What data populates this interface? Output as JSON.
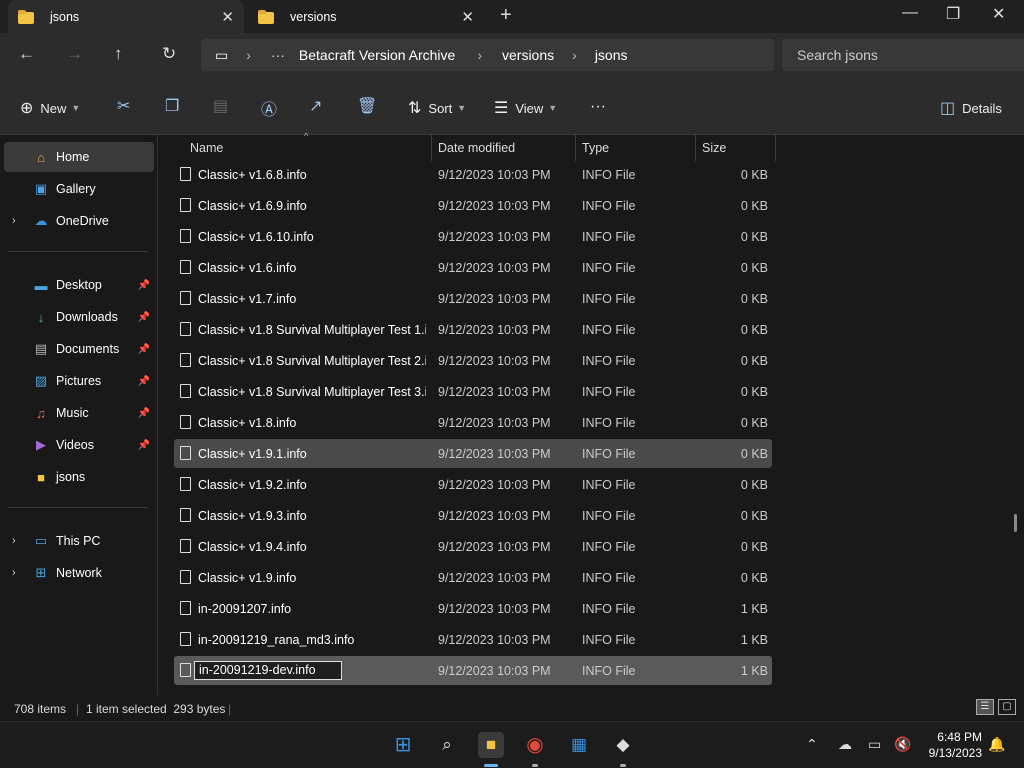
{
  "tabs": [
    {
      "label": "jsons",
      "active": true
    },
    {
      "label": "versions",
      "active": false
    }
  ],
  "breadcrumb": {
    "ellipsis": "···",
    "items": [
      "Betacraft Version Archive",
      "versions",
      "jsons"
    ]
  },
  "search": {
    "placeholder": "Search jsons"
  },
  "commands": {
    "new_label": "New",
    "sort_label": "Sort",
    "view_label": "View",
    "more_label": "···",
    "details_label": "Details"
  },
  "sidebar": {
    "items": [
      {
        "label": "Home",
        "icon": "home-icon",
        "selected": true
      },
      {
        "label": "Gallery",
        "icon": "gallery-icon"
      },
      {
        "label": "OneDrive",
        "icon": "cloud-icon"
      },
      {
        "label": "Desktop",
        "icon": "desktop-icon"
      },
      {
        "label": "Downloads",
        "icon": "download-icon"
      },
      {
        "label": "Documents",
        "icon": "documents-icon"
      },
      {
        "label": "Pictures",
        "icon": "pictures-icon"
      },
      {
        "label": "Music",
        "icon": "music-icon"
      },
      {
        "label": "Videos",
        "icon": "videos-icon"
      },
      {
        "label": "jsons",
        "icon": "folder-icon"
      },
      {
        "label": "This PC",
        "icon": "pc-icon"
      },
      {
        "label": "Network",
        "icon": "network-icon"
      }
    ]
  },
  "columns": {
    "name": "Name",
    "date": "Date modified",
    "type": "Type",
    "size": "Size"
  },
  "files": [
    {
      "name": "Classic+ v1.6.8.info",
      "date": "9/12/2023 10:03 PM",
      "type": "INFO File",
      "size": "0 KB"
    },
    {
      "name": "Classic+ v1.6.9.info",
      "date": "9/12/2023 10:03 PM",
      "type": "INFO File",
      "size": "0 KB"
    },
    {
      "name": "Classic+ v1.6.10.info",
      "date": "9/12/2023 10:03 PM",
      "type": "INFO File",
      "size": "0 KB"
    },
    {
      "name": "Classic+ v1.6.info",
      "date": "9/12/2023 10:03 PM",
      "type": "INFO File",
      "size": "0 KB"
    },
    {
      "name": "Classic+ v1.7.info",
      "date": "9/12/2023 10:03 PM",
      "type": "INFO File",
      "size": "0 KB"
    },
    {
      "name": "Classic+ v1.8 Survival Multiplayer Test 1.i...",
      "date": "9/12/2023 10:03 PM",
      "type": "INFO File",
      "size": "0 KB"
    },
    {
      "name": "Classic+ v1.8 Survival Multiplayer Test 2.i...",
      "date": "9/12/2023 10:03 PM",
      "type": "INFO File",
      "size": "0 KB"
    },
    {
      "name": "Classic+ v1.8 Survival Multiplayer Test 3.i...",
      "date": "9/12/2023 10:03 PM",
      "type": "INFO File",
      "size": "0 KB"
    },
    {
      "name": "Classic+ v1.8.info",
      "date": "9/12/2023 10:03 PM",
      "type": "INFO File",
      "size": "0 KB"
    },
    {
      "name": "Classic+ v1.9.1.info",
      "date": "9/12/2023 10:03 PM",
      "type": "INFO File",
      "size": "0 KB"
    },
    {
      "name": "Classic+ v1.9.2.info",
      "date": "9/12/2023 10:03 PM",
      "type": "INFO File",
      "size": "0 KB"
    },
    {
      "name": "Classic+ v1.9.3.info",
      "date": "9/12/2023 10:03 PM",
      "type": "INFO File",
      "size": "0 KB"
    },
    {
      "name": "Classic+ v1.9.4.info",
      "date": "9/12/2023 10:03 PM",
      "type": "INFO File",
      "size": "0 KB"
    },
    {
      "name": "Classic+ v1.9.info",
      "date": "9/12/2023 10:03 PM",
      "type": "INFO File",
      "size": "0 KB"
    },
    {
      "name": "in-20091207.info",
      "date": "9/12/2023 10:03 PM",
      "type": "INFO File",
      "size": "1 KB"
    },
    {
      "name": "in-20091219_rana_md3.info",
      "date": "9/12/2023 10:03 PM",
      "type": "INFO File",
      "size": "1 KB"
    },
    {
      "name": "in-20091219-dev.info",
      "date": "9/12/2023 10:03 PM",
      "type": "INFO File",
      "size": "1 KB"
    }
  ],
  "status": {
    "count": "708 items",
    "selection": "1 item selected  293 bytes"
  },
  "clock": {
    "time": "6:48 PM",
    "date": "9/13/2023"
  },
  "colors": {
    "accent": "#f3c343",
    "selected": "#5a5a5a",
    "hover": "#4a4a4a"
  }
}
